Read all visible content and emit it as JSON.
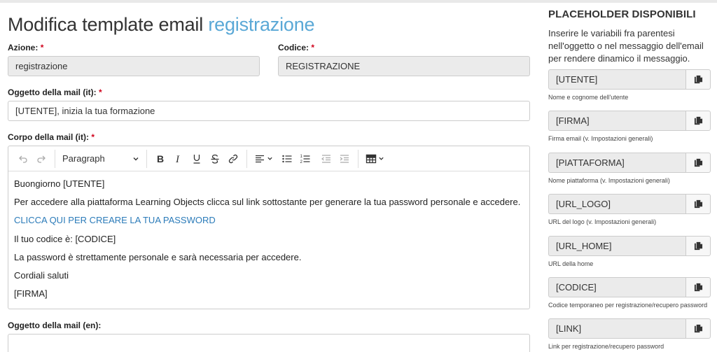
{
  "page": {
    "title_prefix": "Modifica template email",
    "title_highlight": "registrazione"
  },
  "form": {
    "azione_label": "Azione:",
    "azione_value": "registrazione",
    "codice_label": "Codice:",
    "codice_value": "REGISTRAZIONE",
    "required_mark": "*",
    "oggetto_it_label": "Oggetto della mail (it):",
    "oggetto_it_value": "[UTENTE], inizia la tua formazione",
    "corpo_it_label": "Corpo della mail (it):",
    "oggetto_en_label": "Oggetto della mail (en):",
    "oggetto_en_value": ""
  },
  "editor": {
    "block_format": "Paragraph",
    "toolbar_icons": [
      "undo-icon",
      "redo-icon",
      "bold-icon",
      "italic-icon",
      "underline-icon",
      "strikethrough-icon",
      "link-icon",
      "align-icon",
      "bullet-list-icon",
      "numbered-list-icon",
      "outdent-icon",
      "indent-icon",
      "table-icon"
    ],
    "lines": [
      "Buongiorno [UTENTE]",
      "Per accedere alla piattaforma Learning Objects clicca sul link sottostante per generare la tua password personale e accedere.",
      "CLICCA QUI PER CREARE LA TUA PASSWORD",
      "Il tuo codice è: [CODICE]",
      "La password è strettamente personale e sarà necessaria per accedere.",
      "Cordiali saluti",
      "[FIRMA]"
    ],
    "link_color": "#2b7bb9"
  },
  "sidebar": {
    "title": "PLACEHOLDER DISPONIBILI",
    "intro": "Inserire le variabili fra parentesi nell'oggetto o nel messaggio dell'email per rendere dinamico il messaggio.",
    "placeholders": [
      {
        "value": "[UTENTE]",
        "hint": "Nome e cognome dell'utente"
      },
      {
        "value": "[FIRMA]",
        "hint": "Firma email (v. Impostazioni generali)"
      },
      {
        "value": "[PIATTAFORMA]",
        "hint": "Nome piattaforma (v. Impostazioni generali)"
      },
      {
        "value": "[URL_LOGO]",
        "hint": "URL del logo (v. Impostazioni generali)"
      },
      {
        "value": "[URL_HOME]",
        "hint": "URL della home"
      },
      {
        "value": "[CODICE]",
        "hint": "Codice temporaneo per registrazione/recupero password"
      },
      {
        "value": "[LINK]",
        "hint": "Link per registrazione/recupero password"
      }
    ],
    "copy_icon": "copy-icon"
  },
  "colors": {
    "title_highlight": "#5aa8d6",
    "required": "#d0021b",
    "readonly_bg": "#ebebeb"
  }
}
